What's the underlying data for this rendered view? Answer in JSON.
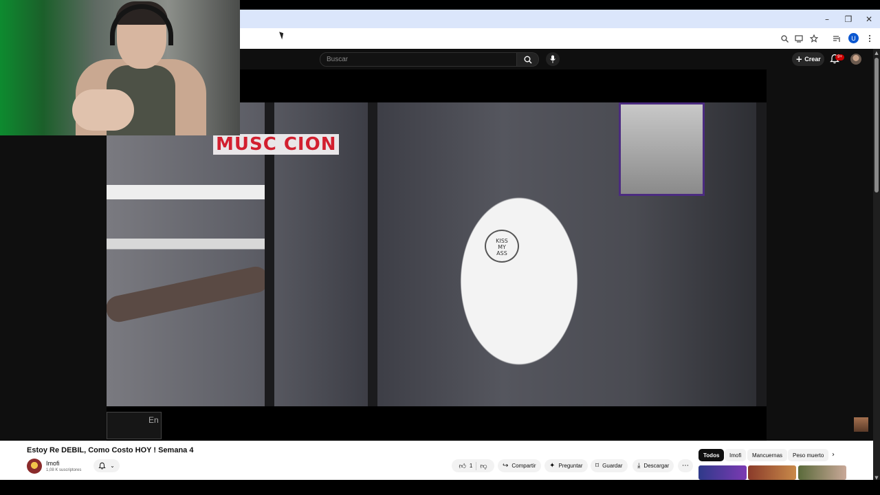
{
  "browser": {
    "minimize": "–",
    "restore": "❐",
    "close": "✕",
    "avatar_letter": "U",
    "icons": [
      "zoom-icon",
      "install-icon",
      "bookmark-star-icon",
      "reading-list-icon",
      "profile-avatar",
      "menu-kebab-icon"
    ]
  },
  "header": {
    "search_placeholder": "Buscar",
    "create_label": "Crear",
    "notifications_badge": "9+"
  },
  "video": {
    "title": "Estoy Re DEBIL, Como Costo HOY ! Semana 4",
    "overlay_text": "En",
    "sign_text": "MUSC  CION"
  },
  "channel": {
    "name": "Imofi",
    "subscribers": "1,08 K suscriptores"
  },
  "actions": {
    "likes": "1",
    "share": "Compartir",
    "ask": "Preguntar",
    "save": "Guardar",
    "download": "Descargar"
  },
  "chips": [
    "Todos",
    "Imofi",
    "Mancuernas",
    "Peso muerto"
  ],
  "colors": {
    "accent_red": "#cc0000",
    "page_dark": "#0f0f0f",
    "chrome_blue": "#dbe6fb"
  }
}
